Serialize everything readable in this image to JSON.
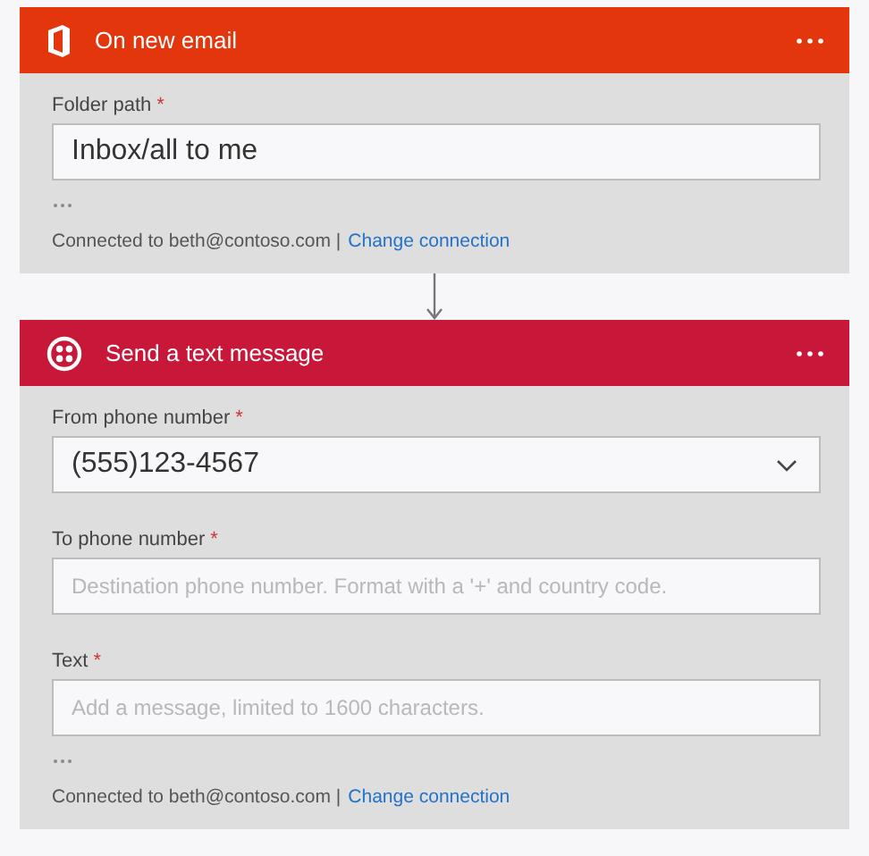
{
  "cards": [
    {
      "title": "On new email",
      "kind": "office",
      "color": "#e3360c",
      "fields": [
        {
          "kind": "text",
          "label": "Folder path",
          "required_mark": "*",
          "value": "Inbox/all to me"
        }
      ],
      "connection": "Connected to beth@contoso.com |",
      "link": "Change connection"
    },
    {
      "title": "Send a text message",
      "kind": "messaging",
      "color": "#c8183a",
      "fields": [
        {
          "kind": "dropdown",
          "label": "From phone number",
          "required_mark": "*",
          "value": "(555)123-4567"
        },
        {
          "kind": "text",
          "label": "To phone number",
          "required_mark": "*",
          "placeholder": "Destination phone number. Format with a '+' and country code."
        },
        {
          "kind": "text",
          "label": "Text",
          "required_mark": "*",
          "placeholder": "Add a message, limited to 1600 characters."
        }
      ],
      "connection": "Connected to beth@contoso.com |",
      "link": "Change connection"
    }
  ]
}
